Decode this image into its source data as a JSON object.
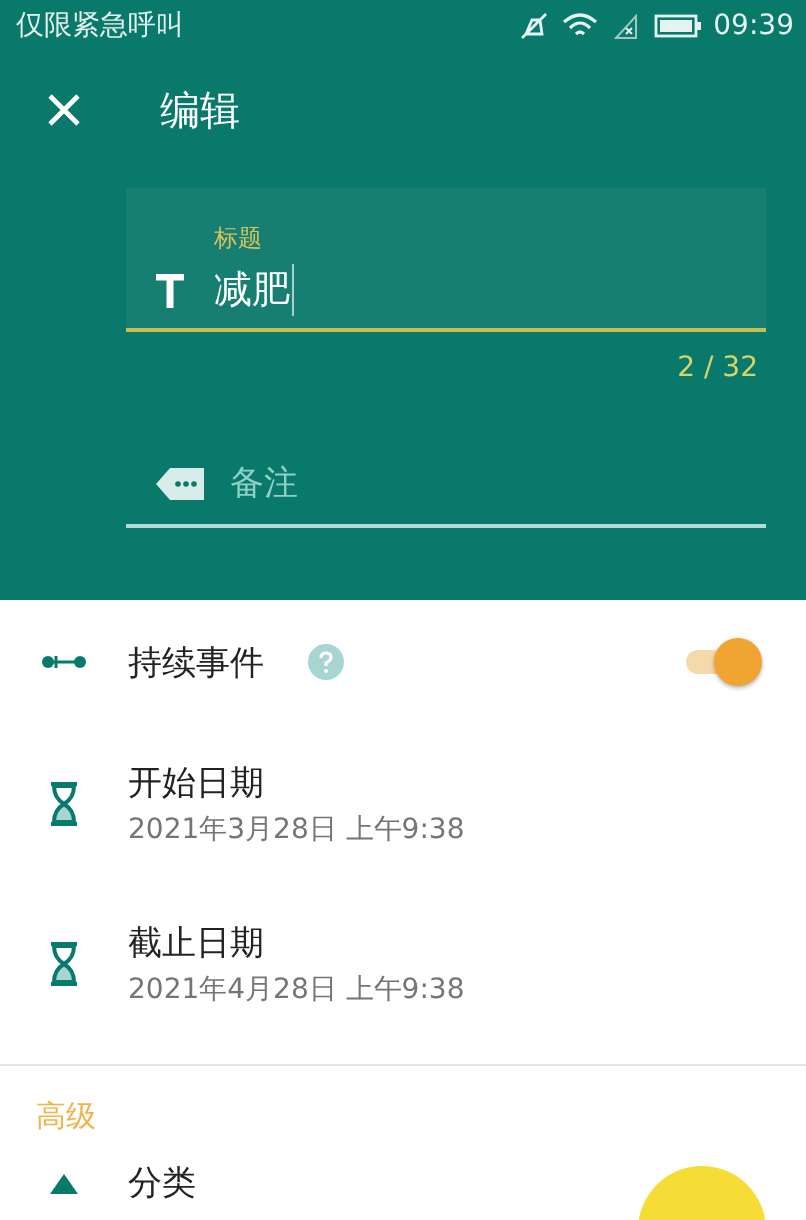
{
  "status_bar": {
    "carrier": "仅限紧急呼叫",
    "time": "09:39"
  },
  "toolbar": {
    "title": "编辑"
  },
  "title_field": {
    "label": "标题",
    "value": "减肥",
    "counter": "2 / 32",
    "focused": true
  },
  "notes_field": {
    "placeholder": "备注"
  },
  "rows": [
    {
      "kind": "switch",
      "label": "持续事件",
      "on": true
    },
    {
      "kind": "date",
      "label": "开始日期",
      "value": "2021年3月28日 上午9:38"
    },
    {
      "kind": "date",
      "label": "截止日期",
      "value": "2021年4月28日 上午9:38"
    }
  ],
  "section": {
    "title": "高级"
  },
  "advanced_rows": [
    {
      "label": "分类"
    }
  ]
}
